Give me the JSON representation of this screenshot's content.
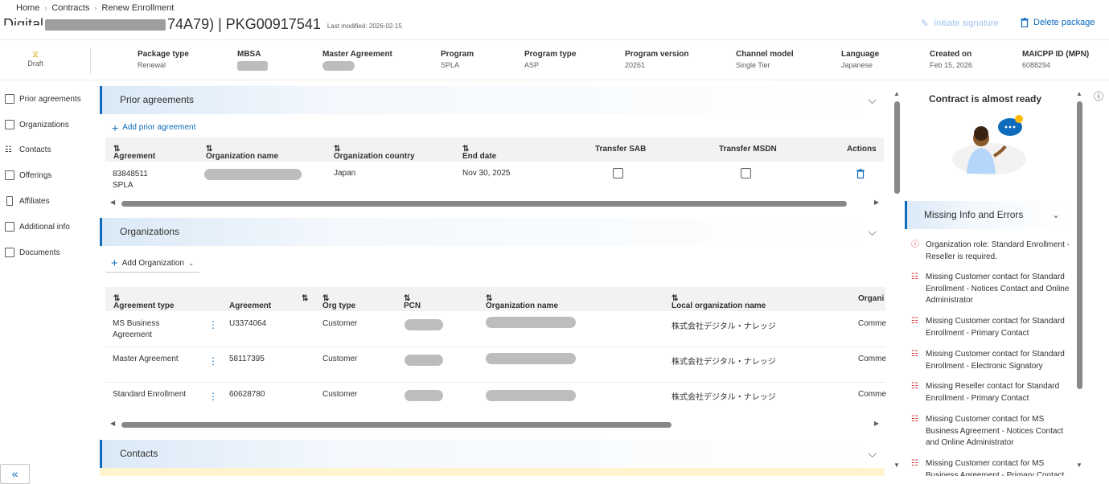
{
  "breadcrumb": [
    "Home",
    "Contracts",
    "Renew Enrollment"
  ],
  "header": {
    "title_prefix": "Digital",
    "title_partial": "74A79) | PKG00917541",
    "last_modified": "Last modified: 2026-02-15",
    "initiate_signature": "Initiate signature",
    "delete_package": "Delete package"
  },
  "status": {
    "label": "Draft"
  },
  "meta": [
    {
      "key": "Package type",
      "value": "Renewal"
    },
    {
      "key": "MBSA",
      "value": ""
    },
    {
      "key": "Master Agreement",
      "value": ""
    },
    {
      "key": "Program",
      "value": "SPLA"
    },
    {
      "key": "Program type",
      "value": "ASP"
    },
    {
      "key": "Program version",
      "value": "20261"
    },
    {
      "key": "Channel model",
      "value": "Single Tier"
    },
    {
      "key": "Language",
      "value": "Japanese"
    },
    {
      "key": "Created on",
      "value": "Feb 15, 2026"
    },
    {
      "key": "MAICPP ID (MPN)",
      "value": "6088294"
    }
  ],
  "nav": [
    {
      "label": "Prior agreements",
      "icon": "prior-agreements-icon"
    },
    {
      "label": "Organizations",
      "icon": "organizations-icon"
    },
    {
      "label": "Contacts",
      "icon": "contacts-icon"
    },
    {
      "label": "Offerings",
      "icon": "offerings-icon"
    },
    {
      "label": "Affiliates",
      "icon": "affiliates-icon"
    },
    {
      "label": "Additional info",
      "icon": "additional-info-icon"
    },
    {
      "label": "Documents",
      "icon": "documents-icon"
    }
  ],
  "prior": {
    "title": "Prior agreements",
    "add_label": "Add prior agreement",
    "columns": [
      "Agreement",
      "Organization name",
      "Organization country",
      "End date",
      "Transfer SAB",
      "Transfer MSDN",
      "Actions"
    ],
    "row": {
      "agreement": "83848511",
      "agreement_sub": "SPLA",
      "country": "Japan",
      "end_date": "Nov 30, 2025"
    }
  },
  "orgs": {
    "title": "Organizations",
    "add_label": "Add Organization",
    "columns": [
      "Agreement type",
      "Agreement",
      "Org type",
      "PCN",
      "Organization name",
      "Local organization name",
      "Organi"
    ],
    "rows": [
      {
        "type_line1": "MS Business",
        "type_line2": "Agreement",
        "agreement": "U3374064",
        "org_type": "Customer",
        "local": "株式会社デジタル・ナレッジ",
        "org": "Comme"
      },
      {
        "type_line1": "Master Agreement",
        "type_line2": "",
        "agreement": "58117395",
        "org_type": "Customer",
        "local": "株式会社デジタル・ナレッジ",
        "org": "Comme"
      },
      {
        "type_line1": "Standard Enrollment",
        "type_line2": "",
        "agreement": "60628780",
        "org_type": "Customer",
        "local": "株式会社デジタル・ナレッジ",
        "org": "Comme"
      }
    ]
  },
  "contacts": {
    "title": "Contacts"
  },
  "panel": {
    "ready_title": "Contract is almost ready",
    "missing_title": "Missing Info and Errors",
    "items": [
      {
        "text": "Organization role: Standard Enrollment - Reseller is required.",
        "icon": "error-circle-icon"
      },
      {
        "text": "Missing Customer contact for Standard Enrollment - Notices Contact and Online Administrator",
        "icon": "people-icon"
      },
      {
        "text": "Missing Customer contact for Standard Enrollment - Primary Contact",
        "icon": "people-icon"
      },
      {
        "text": "Missing Customer contact for Standard Enrollment - Electronic Signatory",
        "icon": "people-icon"
      },
      {
        "text": "Missing Reseller contact for Standard Enrollment - Primary Contact",
        "icon": "people-icon"
      },
      {
        "text": "Missing Customer contact for MS Business Agreement - Notices Contact and Online Administrator",
        "icon": "people-icon"
      },
      {
        "text": "Missing Customer contact for MS Business Agreement - Primary Contact",
        "icon": "people-icon"
      }
    ]
  }
}
